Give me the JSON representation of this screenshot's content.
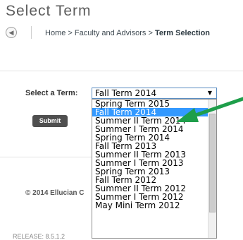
{
  "header": {
    "title": "Select Term",
    "back_icon": "back-arrow-icon",
    "breadcrumb": {
      "home": "Home",
      "sep": ">",
      "parent": "Faculty and Advisors",
      "current": "Term Selection"
    }
  },
  "form": {
    "label": "Select a Term:",
    "selected_value": "Fall Term 2014",
    "submit_label": "Submit",
    "options": [
      "Spring Term 2015",
      "Fall Term 2014",
      "Summer II Term 2014",
      "Summer I Term 2014",
      "Spring Term 2014",
      "Fall Term 2013",
      "Summer II Term 2013",
      "Summer I Term 2013",
      "Spring Term 2013",
      "Fall Term 2012",
      "Summer II Term 2012",
      "Summer I Term 2012",
      "May Mini Term 2012"
    ],
    "highlighted_index": 1
  },
  "footer": {
    "copyright": "© 2014 Ellucian C",
    "release": "RELEASE: 8.5.1.2"
  },
  "colors": {
    "highlight": "#3399ff",
    "annotation_arrow": "#1e9e4a"
  }
}
